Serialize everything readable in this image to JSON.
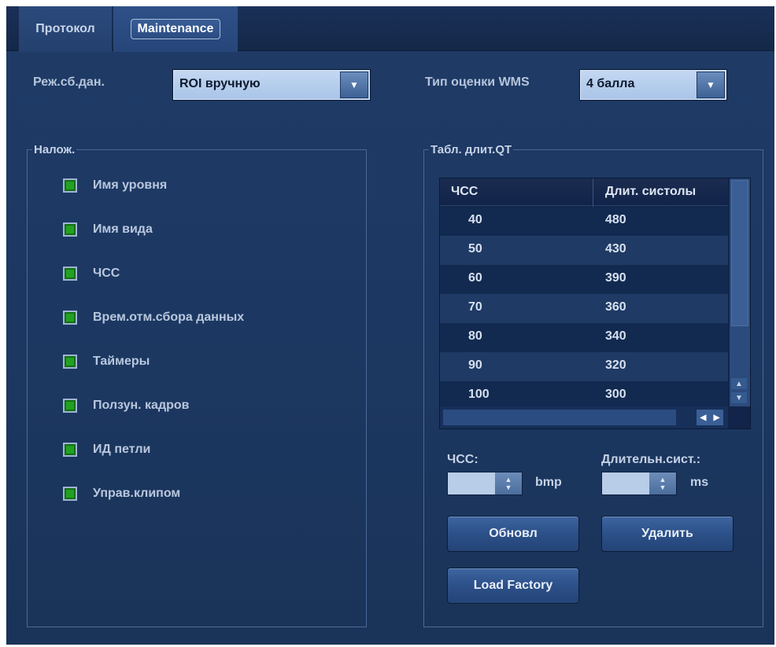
{
  "tabs": [
    "Протокол",
    "Maintenance"
  ],
  "acquisition": {
    "label": "Реж.сб.дан.",
    "value": "ROI вручную"
  },
  "wms": {
    "label": "Тип оценки WMS",
    "value": "4 балла"
  },
  "overlay": {
    "legend": "Налож.",
    "items": [
      {
        "label": "Имя уровня",
        "checked": true
      },
      {
        "label": "Имя вида",
        "checked": true
      },
      {
        "label": "ЧСС",
        "checked": true
      },
      {
        "label": "Врем.отм.сбора данных",
        "checked": true
      },
      {
        "label": "Таймеры",
        "checked": true
      },
      {
        "label": "Ползун. кадров",
        "checked": true
      },
      {
        "label": "ИД петли",
        "checked": true
      },
      {
        "label": "Управ.клипом",
        "checked": true
      }
    ]
  },
  "qt_table": {
    "legend": "Табл. длит.QT",
    "headers": [
      "ЧСС",
      "Длит. систолы"
    ],
    "rows": [
      [
        "40",
        "480"
      ],
      [
        "50",
        "430"
      ],
      [
        "60",
        "390"
      ],
      [
        "70",
        "360"
      ],
      [
        "80",
        "340"
      ],
      [
        "90",
        "320"
      ],
      [
        "100",
        "300"
      ]
    ],
    "hr_label": "ЧСС:",
    "hr_unit": "bmp",
    "sys_label": "Длительн.сист.:",
    "sys_unit": "ms",
    "update_label": "Обновл",
    "delete_label": "Удалить",
    "load_factory_label": "Load Factory"
  },
  "colors": {
    "panel_bg": "#1c3862",
    "checkbox_green": "#22a122",
    "combo_bg": "#b4cdee"
  }
}
